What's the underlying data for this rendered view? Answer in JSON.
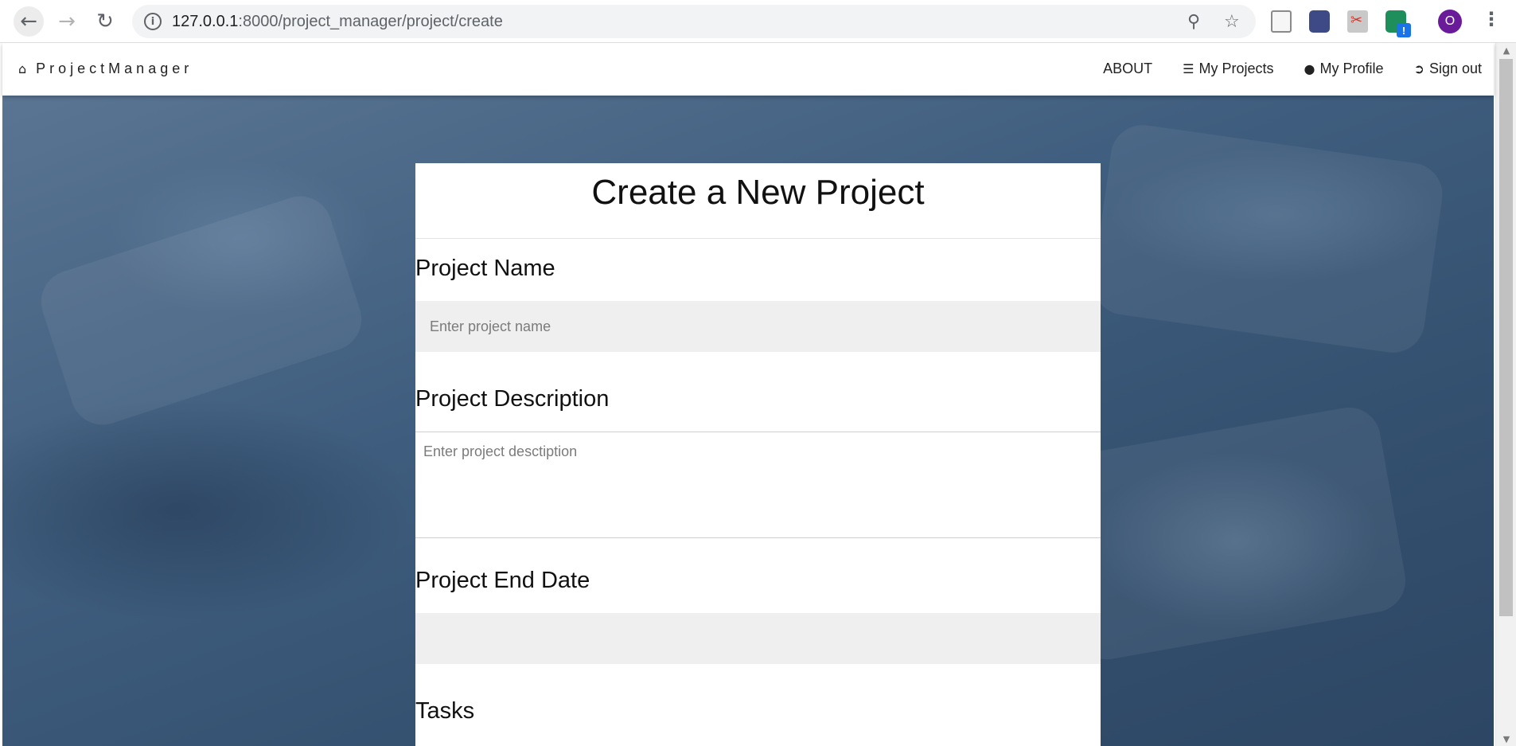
{
  "browser": {
    "url_host": "127.0.0.1",
    "url_rest": ":8000/project_manager/project/create",
    "profile_initial": "O",
    "extension_badge": "!"
  },
  "navbar": {
    "brand": "ProjectManager",
    "items": [
      {
        "label": "ABOUT",
        "icon": ""
      },
      {
        "label": "My Projects",
        "icon": "list-icon"
      },
      {
        "label": "My Profile",
        "icon": "user-icon"
      },
      {
        "label": "Sign out",
        "icon": "sign-out-icon"
      }
    ]
  },
  "form": {
    "title": "Create a New Project",
    "name_label": "Project Name",
    "name_placeholder": "Enter project name",
    "description_label": "Project Description",
    "description_placeholder": "Enter project desctiption",
    "end_date_label": "Project End Date",
    "end_date_value": "",
    "tasks_label": "Tasks"
  }
}
